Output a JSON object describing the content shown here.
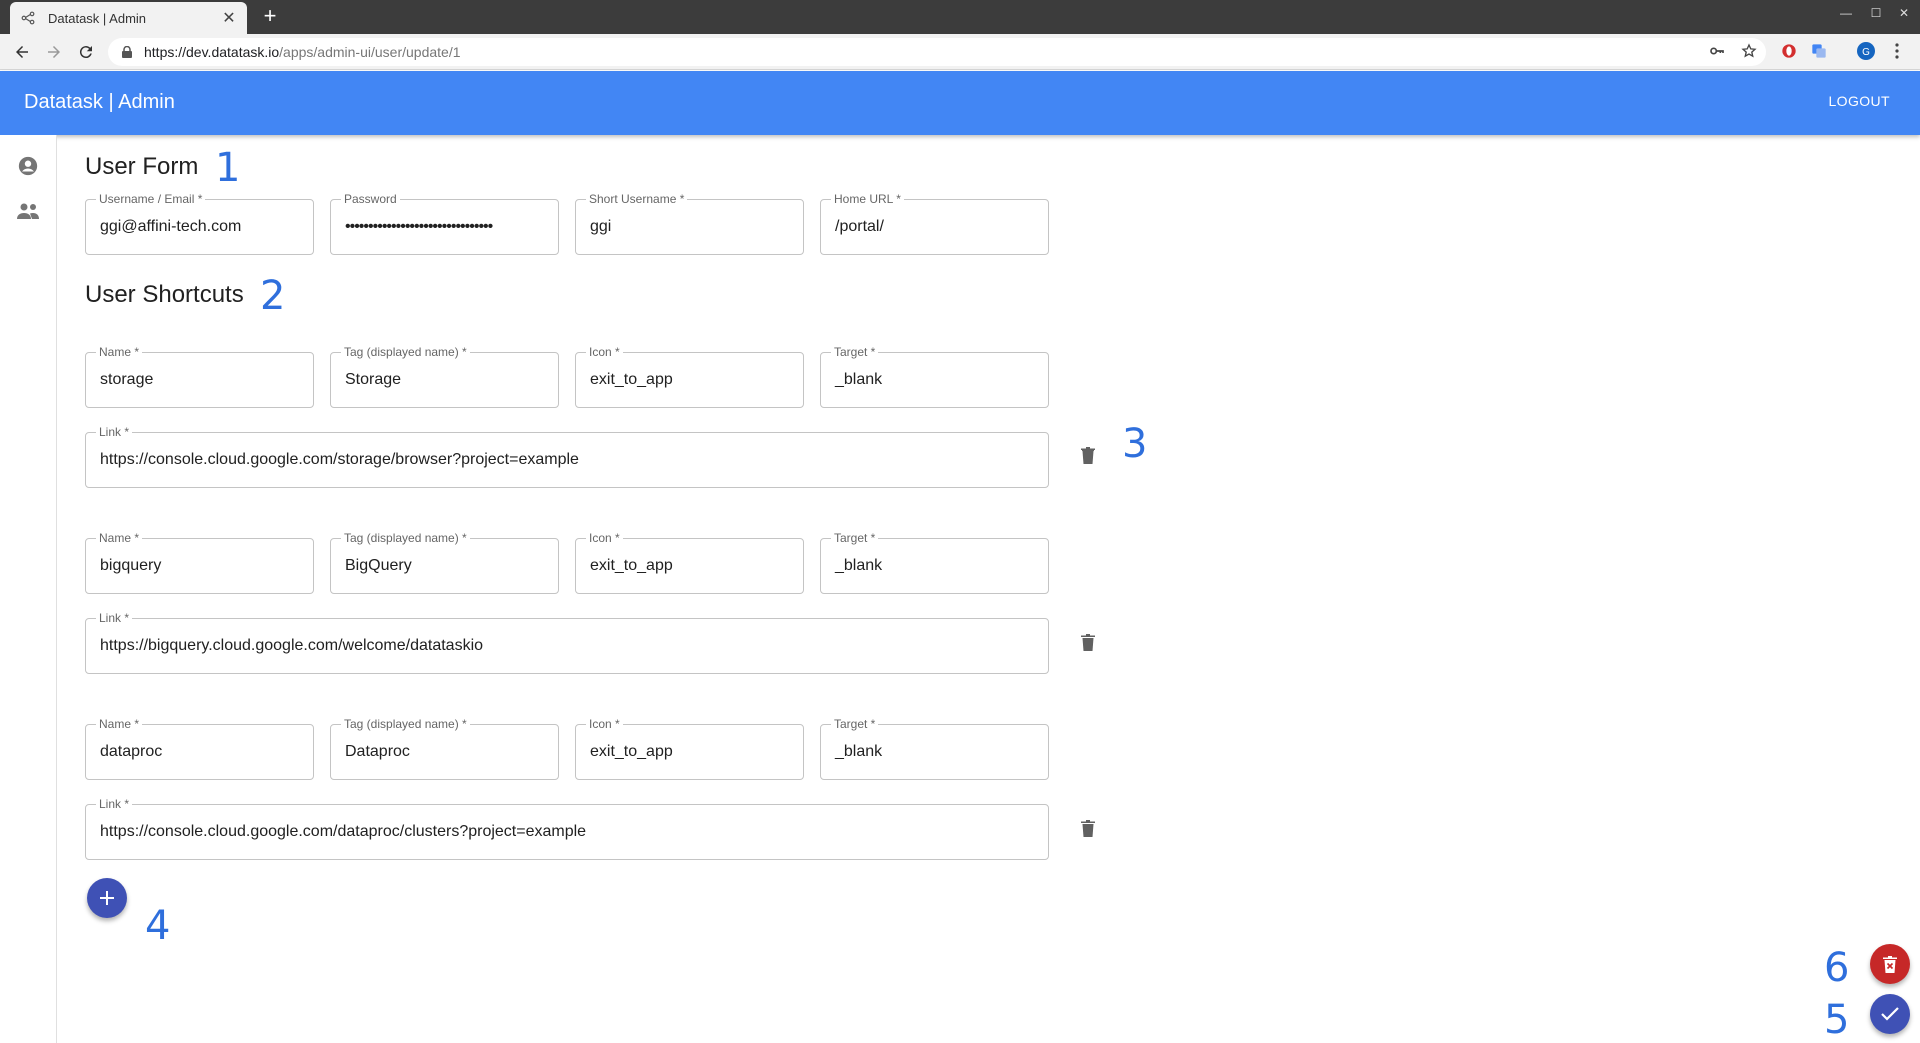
{
  "browser": {
    "tab_title": "Datatask | Admin",
    "url_host": "https://dev.datatask.io",
    "url_path": "/apps/admin-ui/user/update/1",
    "profile_initial": "G"
  },
  "appbar": {
    "title": "Datatask | Admin",
    "logout_label": "LOGOUT"
  },
  "user_form": {
    "title": "User Form",
    "fields": [
      {
        "label": "Username / Email *",
        "value": "ggi@affini-tech.com"
      },
      {
        "label": "Password",
        "value": "••••••••••••••••••••••••••••••••"
      },
      {
        "label": "Short Username *",
        "value": "ggi"
      },
      {
        "label": "Home URL *",
        "value": "/portal/"
      }
    ]
  },
  "shortcuts": {
    "title": "User Shortcuts",
    "labels": {
      "name": "Name *",
      "tag": "Tag (displayed name) *",
      "icon": "Icon *",
      "target": "Target *",
      "link": "Link *"
    },
    "items": [
      {
        "name": "storage",
        "tag": "Storage",
        "icon": "exit_to_app",
        "target": "_blank",
        "link": "https://console.cloud.google.com/storage/browser?project=example"
      },
      {
        "name": "bigquery",
        "tag": "BigQuery",
        "icon": "exit_to_app",
        "target": "_blank",
        "link": "https://bigquery.cloud.google.com/welcome/datataskio"
      },
      {
        "name": "dataproc",
        "tag": "Dataproc",
        "icon": "exit_to_app",
        "target": "_blank",
        "link": "https://console.cloud.google.com/dataproc/clusters?project=example"
      }
    ]
  },
  "annotations": [
    "1",
    "2",
    "3",
    "4",
    "5",
    "6"
  ],
  "colors": {
    "appbar": "#4286f4",
    "fab_primary": "#3f51b5",
    "fab_danger": "#c62828",
    "annotation": "#2f6fdc"
  }
}
